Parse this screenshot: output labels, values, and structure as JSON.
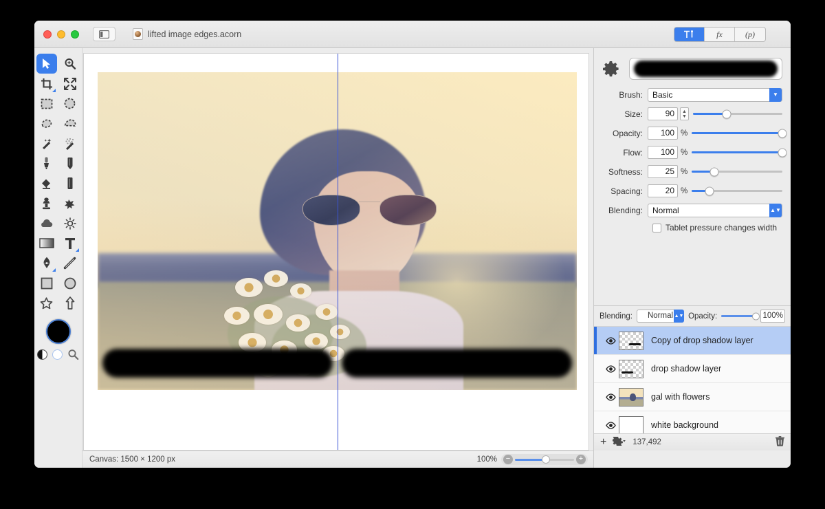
{
  "window": {
    "title": "lifted image edges.acorn",
    "traffic_lights": [
      "close",
      "minimize",
      "maximize"
    ],
    "sidebar_toggle_icon": "sidebar-toggle-icon",
    "document_icon": "document-icon"
  },
  "inspector_tabs": [
    {
      "id": "tools",
      "label": "↑↕",
      "icon": "tool-options-icon",
      "active": true
    },
    {
      "id": "filters",
      "label": "fx",
      "icon": "effects-icon",
      "active": false
    },
    {
      "id": "properties",
      "label": "(p)",
      "icon": "properties-icon",
      "active": false
    }
  ],
  "brush_panel": {
    "gear_icon": "gear-icon",
    "preview_name": "brush-stroke-preview",
    "brush": {
      "label": "Brush:",
      "value": "Basic"
    },
    "params": [
      {
        "label": "Size:",
        "value": "90",
        "unit": "",
        "fill_pct": 38,
        "stepper": true
      },
      {
        "label": "Opacity:",
        "value": "100",
        "unit": "%",
        "fill_pct": 100,
        "stepper": false
      },
      {
        "label": "Flow:",
        "value": "100",
        "unit": "%",
        "fill_pct": 100,
        "stepper": false
      },
      {
        "label": "Softness:",
        "value": "25",
        "unit": "%",
        "fill_pct": 25,
        "stepper": false
      },
      {
        "label": "Spacing:",
        "value": "20",
        "unit": "%",
        "fill_pct": 20,
        "stepper": false
      }
    ],
    "blending": {
      "label": "Blending:",
      "value": "Normal"
    },
    "tablet": {
      "label": "Tablet pressure changes width",
      "checked": false
    }
  },
  "layers_panel": {
    "blending": {
      "label": "Blending:",
      "value": "Normal"
    },
    "opacity": {
      "label": "Opacity:",
      "value": "100%"
    },
    "rows": [
      {
        "name": "Copy of drop shadow layer",
        "thumb": "transparent-stroke",
        "visible": true,
        "selected": true
      },
      {
        "name": "drop shadow layer",
        "thumb": "transparent-stroke",
        "visible": true,
        "selected": false
      },
      {
        "name": "gal with flowers",
        "thumb": "photo",
        "visible": true,
        "selected": false
      },
      {
        "name": "white background",
        "thumb": "white",
        "visible": true,
        "selected": false
      }
    ],
    "footer": {
      "add_label": "+",
      "gear_icon": "layer-actions-gear-icon",
      "count": "137,492",
      "trash_icon": "trash-icon"
    }
  },
  "status_bar": {
    "canvas_size": "Canvas: 1500 × 1200 px",
    "zoom": "100%",
    "zoom_out_icon": "zoom-out-icon",
    "zoom_in_icon": "zoom-in-icon"
  },
  "tools": [
    {
      "name": "move-tool",
      "selected": true
    },
    {
      "name": "zoom-tool",
      "selected": false
    },
    {
      "name": "crop-tool",
      "selected": false
    },
    {
      "name": "transform-tool",
      "selected": false
    },
    {
      "name": "rectangular-select-tool",
      "selected": false
    },
    {
      "name": "elliptical-select-tool",
      "selected": false
    },
    {
      "name": "lasso-select-tool",
      "selected": false
    },
    {
      "name": "polygon-select-tool",
      "selected": false
    },
    {
      "name": "magic-wand-tool",
      "selected": false
    },
    {
      "name": "instant-alpha-tool",
      "selected": false
    },
    {
      "name": "brush-tool",
      "selected": false
    },
    {
      "name": "pencil-tool",
      "selected": false
    },
    {
      "name": "paint-bucket-tool",
      "selected": false
    },
    {
      "name": "eraser-tool",
      "selected": false
    },
    {
      "name": "clone-stamp-tool",
      "selected": false
    },
    {
      "name": "smudge-tool",
      "selected": false
    },
    {
      "name": "blur-tool",
      "selected": false
    },
    {
      "name": "dodge-tool",
      "selected": false
    },
    {
      "name": "gradient-tool",
      "selected": false
    },
    {
      "name": "text-tool",
      "selected": false
    },
    {
      "name": "pen-tool",
      "selected": false
    },
    {
      "name": "line-tool",
      "selected": false
    },
    {
      "name": "rectangle-shape-tool",
      "selected": false
    },
    {
      "name": "ellipse-shape-tool",
      "selected": false
    },
    {
      "name": "star-shape-tool",
      "selected": false
    },
    {
      "name": "arrow-shape-tool",
      "selected": false
    }
  ],
  "color_well": {
    "foreground": "#000000",
    "background": "#ffffff"
  },
  "colors": {
    "accent": "#3b7eec",
    "selection": "#b5cdf5",
    "selection_bar": "#2f6fe0",
    "panel": "#ececec",
    "guide": "#3b55d6"
  },
  "canvas": {
    "guide_line": "vertical-guide",
    "strokes": 2
  }
}
